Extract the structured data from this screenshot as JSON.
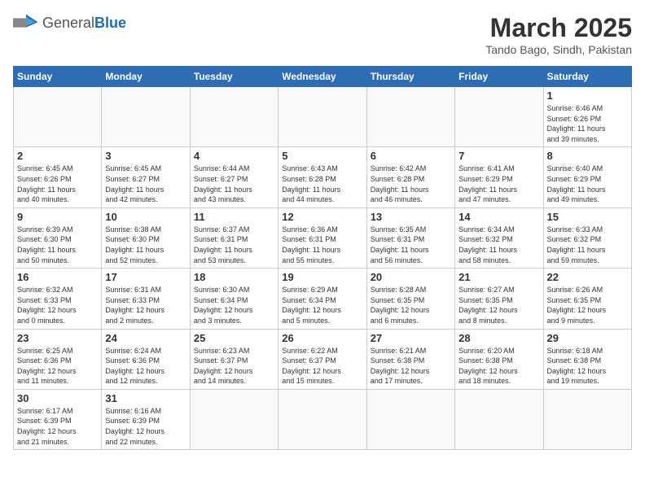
{
  "header": {
    "logo_general": "General",
    "logo_blue": "Blue",
    "month_title": "March 2025",
    "subtitle": "Tando Bago, Sindh, Pakistan"
  },
  "days_of_week": [
    "Sunday",
    "Monday",
    "Tuesday",
    "Wednesday",
    "Thursday",
    "Friday",
    "Saturday"
  ],
  "weeks": [
    [
      {
        "day": "",
        "info": ""
      },
      {
        "day": "",
        "info": ""
      },
      {
        "day": "",
        "info": ""
      },
      {
        "day": "",
        "info": ""
      },
      {
        "day": "",
        "info": ""
      },
      {
        "day": "",
        "info": ""
      },
      {
        "day": "1",
        "info": "Sunrise: 6:46 AM\nSunset: 6:26 PM\nDaylight: 11 hours\nand 39 minutes."
      }
    ],
    [
      {
        "day": "2",
        "info": "Sunrise: 6:45 AM\nSunset: 6:26 PM\nDaylight: 11 hours\nand 40 minutes."
      },
      {
        "day": "3",
        "info": "Sunrise: 6:45 AM\nSunset: 6:27 PM\nDaylight: 11 hours\nand 42 minutes."
      },
      {
        "day": "4",
        "info": "Sunrise: 6:44 AM\nSunset: 6:27 PM\nDaylight: 11 hours\nand 43 minutes."
      },
      {
        "day": "5",
        "info": "Sunrise: 6:43 AM\nSunset: 6:28 PM\nDaylight: 11 hours\nand 44 minutes."
      },
      {
        "day": "6",
        "info": "Sunrise: 6:42 AM\nSunset: 6:28 PM\nDaylight: 11 hours\nand 46 minutes."
      },
      {
        "day": "7",
        "info": "Sunrise: 6:41 AM\nSunset: 6:29 PM\nDaylight: 11 hours\nand 47 minutes."
      },
      {
        "day": "8",
        "info": "Sunrise: 6:40 AM\nSunset: 6:29 PM\nDaylight: 11 hours\nand 49 minutes."
      }
    ],
    [
      {
        "day": "9",
        "info": "Sunrise: 6:39 AM\nSunset: 6:30 PM\nDaylight: 11 hours\nand 50 minutes."
      },
      {
        "day": "10",
        "info": "Sunrise: 6:38 AM\nSunset: 6:30 PM\nDaylight: 11 hours\nand 52 minutes."
      },
      {
        "day": "11",
        "info": "Sunrise: 6:37 AM\nSunset: 6:31 PM\nDaylight: 11 hours\nand 53 minutes."
      },
      {
        "day": "12",
        "info": "Sunrise: 6:36 AM\nSunset: 6:31 PM\nDaylight: 11 hours\nand 55 minutes."
      },
      {
        "day": "13",
        "info": "Sunrise: 6:35 AM\nSunset: 6:31 PM\nDaylight: 11 hours\nand 56 minutes."
      },
      {
        "day": "14",
        "info": "Sunrise: 6:34 AM\nSunset: 6:32 PM\nDaylight: 11 hours\nand 58 minutes."
      },
      {
        "day": "15",
        "info": "Sunrise: 6:33 AM\nSunset: 6:32 PM\nDaylight: 11 hours\nand 59 minutes."
      }
    ],
    [
      {
        "day": "16",
        "info": "Sunrise: 6:32 AM\nSunset: 6:33 PM\nDaylight: 12 hours\nand 0 minutes."
      },
      {
        "day": "17",
        "info": "Sunrise: 6:31 AM\nSunset: 6:33 PM\nDaylight: 12 hours\nand 2 minutes."
      },
      {
        "day": "18",
        "info": "Sunrise: 6:30 AM\nSunset: 6:34 PM\nDaylight: 12 hours\nand 3 minutes."
      },
      {
        "day": "19",
        "info": "Sunrise: 6:29 AM\nSunset: 6:34 PM\nDaylight: 12 hours\nand 5 minutes."
      },
      {
        "day": "20",
        "info": "Sunrise: 6:28 AM\nSunset: 6:35 PM\nDaylight: 12 hours\nand 6 minutes."
      },
      {
        "day": "21",
        "info": "Sunrise: 6:27 AM\nSunset: 6:35 PM\nDaylight: 12 hours\nand 8 minutes."
      },
      {
        "day": "22",
        "info": "Sunrise: 6:26 AM\nSunset: 6:35 PM\nDaylight: 12 hours\nand 9 minutes."
      }
    ],
    [
      {
        "day": "23",
        "info": "Sunrise: 6:25 AM\nSunset: 6:36 PM\nDaylight: 12 hours\nand 11 minutes."
      },
      {
        "day": "24",
        "info": "Sunrise: 6:24 AM\nSunset: 6:36 PM\nDaylight: 12 hours\nand 12 minutes."
      },
      {
        "day": "25",
        "info": "Sunrise: 6:23 AM\nSunset: 6:37 PM\nDaylight: 12 hours\nand 14 minutes."
      },
      {
        "day": "26",
        "info": "Sunrise: 6:22 AM\nSunset: 6:37 PM\nDaylight: 12 hours\nand 15 minutes."
      },
      {
        "day": "27",
        "info": "Sunrise: 6:21 AM\nSunset: 6:38 PM\nDaylight: 12 hours\nand 17 minutes."
      },
      {
        "day": "28",
        "info": "Sunrise: 6:20 AM\nSunset: 6:38 PM\nDaylight: 12 hours\nand 18 minutes."
      },
      {
        "day": "29",
        "info": "Sunrise: 6:18 AM\nSunset: 6:38 PM\nDaylight: 12 hours\nand 19 minutes."
      }
    ],
    [
      {
        "day": "30",
        "info": "Sunrise: 6:17 AM\nSunset: 6:39 PM\nDaylight: 12 hours\nand 21 minutes."
      },
      {
        "day": "31",
        "info": "Sunrise: 6:16 AM\nSunset: 6:39 PM\nDaylight: 12 hours\nand 22 minutes."
      },
      {
        "day": "",
        "info": ""
      },
      {
        "day": "",
        "info": ""
      },
      {
        "day": "",
        "info": ""
      },
      {
        "day": "",
        "info": ""
      },
      {
        "day": "",
        "info": ""
      }
    ]
  ]
}
